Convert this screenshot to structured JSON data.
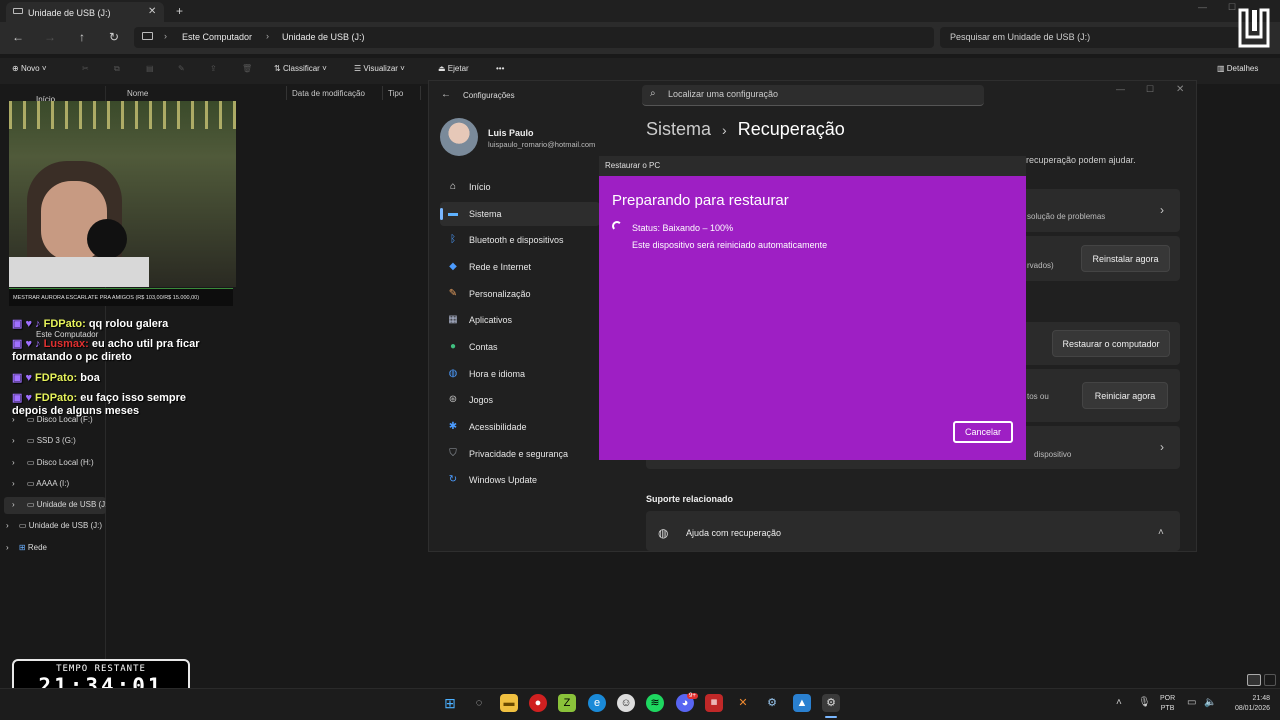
{
  "explorer": {
    "tab_title": "Unidade de USB (J:)",
    "breadcrumb": [
      "Este Computador",
      "Unidade de USB (J:)"
    ],
    "search_placeholder": "Pesquisar em Unidade de USB (J:)",
    "toolbar": {
      "new_label": "Novo",
      "sort_label": "Classificar",
      "view_label": "Visualizar",
      "eject_label": "Ejetar",
      "more_label": "•••",
      "details_label": "Detalhes"
    },
    "columns": [
      "Nome",
      "Data de modificação",
      "Tipo"
    ],
    "tree": {
      "home": "Início",
      "this_pc": "Este Computador",
      "items": [
        "Disco Local (F:)",
        "SSD 3 (G:)",
        "Disco Local (H:)",
        "AAAA (I:)",
        "Unidade de USB (J:)"
      ],
      "usb_root": "Unidade de USB (J:)",
      "network": "Rede"
    }
  },
  "stream": {
    "cam_caption": "MESTRAR AURORA ESCARLATE PRA AMIGOS (R$ 103,00/R$ 15.000,00)",
    "chat": [
      {
        "user": "FDPato:",
        "text": "qq rolou galera"
      },
      {
        "user": "Lusmax:",
        "text": "eu acho util pra ficar formatando o pc direto"
      },
      {
        "user": "FDPato:",
        "text": "boa"
      },
      {
        "user": "FDPato:",
        "text": "eu faço isso sempre depois de alguns meses"
      }
    ],
    "timer_label": "TEMPO RESTANTE",
    "timer_value": "21:34:01"
  },
  "settings": {
    "title": "Configurações",
    "search_placeholder": "Localizar uma configuração",
    "user_name": "Luis Paulo",
    "user_email": "luispaulo_romario@hotmail.com",
    "breadcrumb_parent": "Sistema",
    "breadcrumb_current": "Recuperação",
    "nav": [
      {
        "label": "Início",
        "icon": "home-icon"
      },
      {
        "label": "Sistema",
        "icon": "system-icon"
      },
      {
        "label": "Bluetooth e dispositivos",
        "icon": "bluetooth-icon"
      },
      {
        "label": "Rede e Internet",
        "icon": "wifi-icon"
      },
      {
        "label": "Personalização",
        "icon": "brush-icon"
      },
      {
        "label": "Aplicativos",
        "icon": "apps-icon"
      },
      {
        "label": "Contas",
        "icon": "account-icon"
      },
      {
        "label": "Hora e idioma",
        "icon": "globe-icon"
      },
      {
        "label": "Jogos",
        "icon": "gamepad-icon"
      },
      {
        "label": "Acessibilidade",
        "icon": "accessibility-icon"
      },
      {
        "label": "Privacidade e segurança",
        "icon": "shield-icon"
      },
      {
        "label": "Windows Update",
        "icon": "update-icon"
      }
    ],
    "intro_fragment": "recuperação podem ajudar.",
    "troubleshoot_fragment": "solução de problemas",
    "reinstall_fragment": "rvados)",
    "reinstall_button": "Reinstalar agora",
    "reset_button": "Restaurar o computador",
    "advanced_fragment": "tos ou",
    "restart_button": "Reiniciar agora",
    "device_fragment": "dispositivo",
    "related_heading": "Suporte relacionado",
    "help_item": "Ajuda com recuperação"
  },
  "dialog": {
    "window_title": "Restaurar o PC",
    "heading": "Preparando para restaurar",
    "status": "Status: Baixando – 100%",
    "subtext": "Este dispositivo será reiniciado automaticamente",
    "cancel_label": "Cancelar",
    "background_color": "#9e1fc4"
  },
  "taskbar": {
    "language": "POR",
    "layout": "PTB",
    "time": "21:48",
    "date": "08/01/2026",
    "discord_badge": "9+"
  }
}
